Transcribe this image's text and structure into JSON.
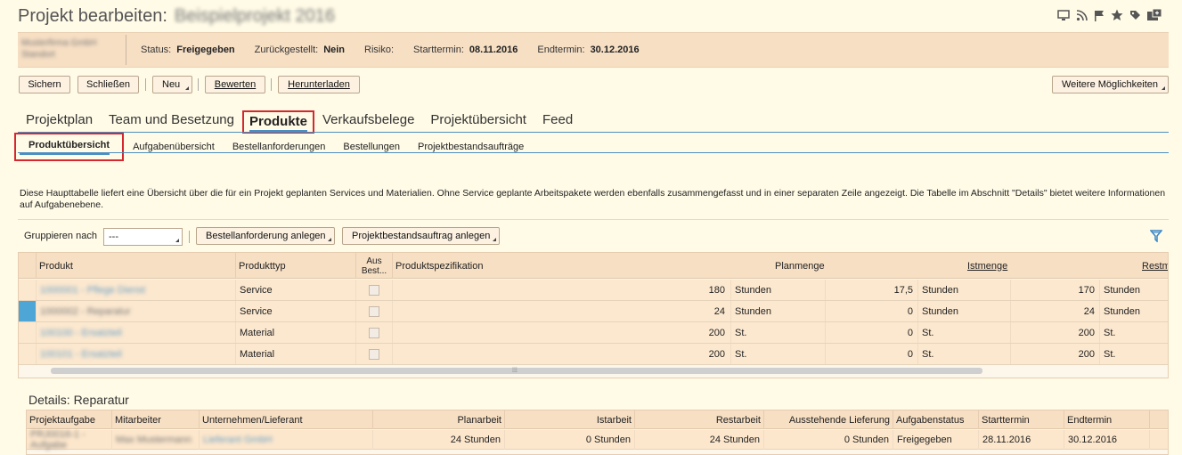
{
  "page": {
    "title": "Projekt bearbeiten:",
    "project_name": "Beispielprojekt 2016"
  },
  "header": {
    "org_line1": "Musterfirma GmbH",
    "org_line2": "Standort",
    "status_label": "Status:",
    "status_value": "Freigegeben",
    "zurueck_label": "Zurückgestellt:",
    "zurueck_value": "Nein",
    "risiko_label": "Risiko:",
    "start_label": "Starttermin:",
    "start_value": "08.11.2016",
    "end_label": "Endtermin:",
    "end_value": "30.12.2016"
  },
  "toolbar": {
    "sichern": "Sichern",
    "schliessen": "Schließen",
    "neu": "Neu",
    "bewerten": "Bewerten",
    "herunterladen": "Herunterladen",
    "weitere": "Weitere Möglichkeiten"
  },
  "tabs": [
    "Projektplan",
    "Team und Besetzung",
    "Produkte",
    "Verkaufsbelege",
    "Projektübersicht",
    "Feed"
  ],
  "subtabs": [
    "Produktübersicht",
    "Aufgabenübersicht",
    "Bestellanforderungen",
    "Bestellungen",
    "Projektbestandsaufträge"
  ],
  "description": "Diese Haupttabelle liefert eine Übersicht über die für ein Projekt geplanten Services und Materialien. Ohne Service geplante Arbeitspakete werden ebenfalls zusammengefasst und in einer separaten Zeile angezeigt. Die Tabelle im Abschnitt \"Details\" bietet weitere Informationen auf Aufgabenebene.",
  "toolbar2": {
    "gruppieren_label": "Gruppieren nach",
    "gruppieren_value": "---",
    "bestellanforderung": "Bestellanforderung anlegen",
    "projektbestand": "Projektbestandsauftrag anlegen"
  },
  "table": {
    "headers": {
      "produkt": "Produkt",
      "produkttyp": "Produkttyp",
      "aus_best_1": "Aus",
      "aus_best_2": "Best...",
      "spezifikation": "Produktspezifikation",
      "planmenge": "Planmenge",
      "istmenge": "Istmenge",
      "restmenge": "Restmenge"
    },
    "rows": [
      {
        "produkt": "1000001 - Pflege Dienst",
        "typ": "Service",
        "plan": "180",
        "plan_unit": "Stunden",
        "ist": "17,5",
        "ist_unit": "Stunden",
        "rest": "170",
        "rest_unit": "Stunden"
      },
      {
        "produkt": "1000002 - Reparatur",
        "typ": "Service",
        "plan": "24",
        "plan_unit": "Stunden",
        "ist": "0",
        "ist_unit": "Stunden",
        "rest": "24",
        "rest_unit": "Stunden"
      },
      {
        "produkt": "100100 - Ersatzteil",
        "typ": "Material",
        "plan": "200",
        "plan_unit": "St.",
        "ist": "0",
        "ist_unit": "St.",
        "rest": "200",
        "rest_unit": "St."
      },
      {
        "produkt": "100101 - Ersatzteil",
        "typ": "Material",
        "plan": "200",
        "plan_unit": "St.",
        "ist": "0",
        "ist_unit": "St.",
        "rest": "200",
        "rest_unit": "St."
      }
    ]
  },
  "details": {
    "title": "Details: Reparatur",
    "headers": {
      "aufgabe": "Projektaufgabe",
      "mitarbeiter": "Mitarbeiter",
      "lieferant": "Unternehmen/Lieferant",
      "planarbeit": "Planarbeit",
      "istarbeit": "Istarbeit",
      "restarbeit": "Restarbeit",
      "ausstehend": "Ausstehende Lieferung",
      "status": "Aufgabenstatus",
      "start": "Starttermin",
      "end": "Endtermin"
    },
    "row": {
      "aufgabe": "PRJ0016-1 - Aufgabe",
      "mitarbeiter": "Max Mustermann",
      "lieferant": "Lieferant GmbH",
      "planarbeit": "24 Stunden",
      "istarbeit": "0 Stunden",
      "restarbeit": "24 Stunden",
      "ausstehend": "0 Stunden",
      "status": "Freigegeben",
      "start": "28.11.2016",
      "end": "30.12.2016"
    }
  },
  "colors": {
    "accent": "#4b8fc2",
    "highlight": "#d4272e",
    "band": "#f7dfc4",
    "background": "#fffbe7"
  },
  "icons": [
    "screen-icon",
    "rss-icon",
    "flag-icon",
    "star-icon",
    "tag-icon",
    "add-window-icon",
    "filter-icon"
  ]
}
